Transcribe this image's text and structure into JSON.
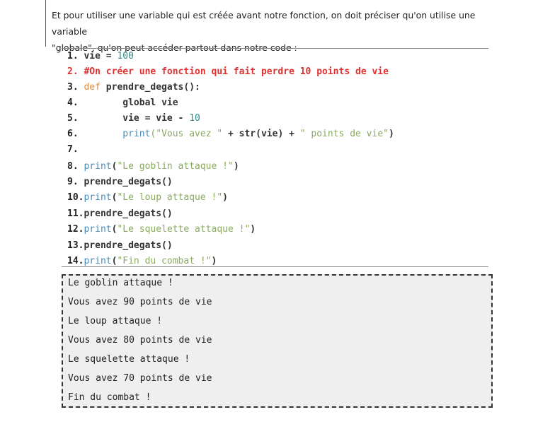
{
  "intro": {
    "line1": "Et pour utiliser une variable qui est créée avant notre fonction, on doit préciser qu'on utilise une variable",
    "line2": "\"globale\", qu'on peut accéder partout dans notre code :"
  },
  "code": {
    "l1": {
      "num": "1. ",
      "a": "vie = ",
      "b": "100"
    },
    "l2": {
      "num": "2. ",
      "comment": "#On créer une fonction qui fait perdre 10 points de vie"
    },
    "l3": {
      "num": "3. ",
      "kw": "def",
      "rest": " prendre_degats():"
    },
    "l4": {
      "num": "4.  ",
      "indent": "      ",
      "rest": "global vie"
    },
    "l5": {
      "num": "5.  ",
      "indent": "      ",
      "a": "vie = vie - ",
      "b": "10"
    },
    "l6": {
      "num": "6.  ",
      "indent": "      ",
      "fn": "print",
      "s1": "(\"Vous avez \"",
      "mid": " + str(vie) + ",
      "s2": "\" points de vie\"",
      "end": ")"
    },
    "l7": {
      "num": "7."
    },
    "l8": {
      "num": "8. ",
      "fn": "print",
      "p1": "(",
      "s": "\"Le goblin attaque !\"",
      "p2": ")"
    },
    "l9": {
      "num": "9. ",
      "rest": "prendre_degats()"
    },
    "l10": {
      "num": "10.",
      "fn": "print",
      "p1": "(",
      "s": "\"Le loup attaque !\"",
      "p2": ")"
    },
    "l11": {
      "num": "11.",
      "rest": "prendre_degats()"
    },
    "l12": {
      "num": "12.",
      "fn": "print",
      "p1": "(",
      "s": "\"Le squelette attaque !\"",
      "p2": ")"
    },
    "l13": {
      "num": "13.",
      "rest": "prendre_degats()"
    },
    "l14": {
      "num": "14.",
      "fn": "print",
      "p1": "(",
      "s": "\"Fin du combat !\"",
      "p2": ")"
    }
  },
  "output": [
    "Le goblin attaque !",
    "Vous avez 90 points de vie",
    "Le loup attaque !",
    "Vous avez 80 points de vie",
    "Le squelette attaque !",
    "Vous avez 70 points de vie",
    "Fin du combat !"
  ],
  "colors": {
    "keyword": "#e08a3c",
    "builtin": "#4a8bb8",
    "string": "#8aaa62",
    "number": "#2e8b8b",
    "comment": "#e03030",
    "output_background": "#efefef"
  }
}
